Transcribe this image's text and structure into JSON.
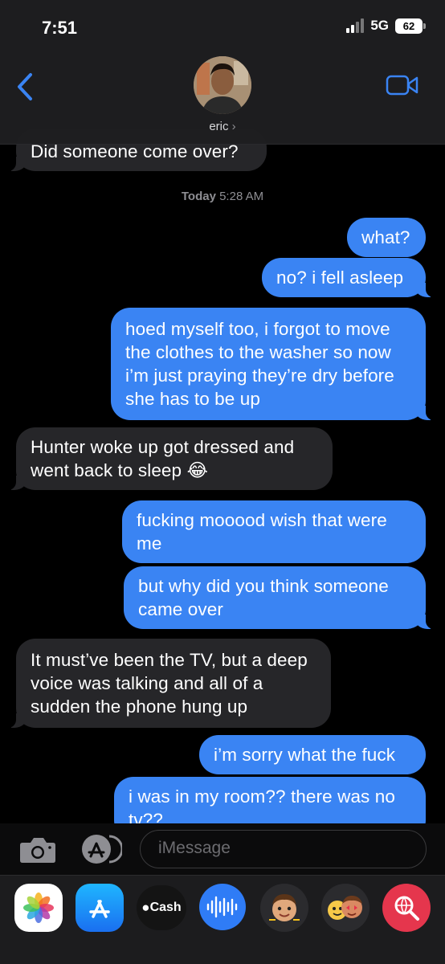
{
  "status_bar": {
    "time": "7:51",
    "network": "5G",
    "battery": "62"
  },
  "header": {
    "contact_name": "eric",
    "chevron": "›"
  },
  "chat": {
    "timestamp_day": "Today",
    "timestamp_time": "5:28 AM",
    "messages": [
      {
        "from": "them",
        "text": "Did someone come over?"
      },
      {
        "from": "me",
        "text": "what?"
      },
      {
        "from": "me",
        "text": "no? i fell asleep"
      },
      {
        "from": "me",
        "text": "hoed myself too, i forgot to move the clothes to the washer so now i’m just praying they’re dry before she has to be up"
      },
      {
        "from": "them",
        "text": "Hunter woke up got dressed and went back to sleep 😂"
      },
      {
        "from": "me",
        "text": "fucking mooood wish that were me"
      },
      {
        "from": "me",
        "text": "but why did you think someone came over"
      },
      {
        "from": "them",
        "text": "It must’ve been the TV, but a deep voice was talking and all of a sudden the phone hung up"
      },
      {
        "from": "me",
        "text": "i’m sorry what the fuck"
      },
      {
        "from": "me",
        "text": "i was in my room?? there was no tv??"
      }
    ]
  },
  "input": {
    "placeholder": "iMessage"
  },
  "drawer": {
    "apps": [
      "photos-icon",
      "app-store-icon",
      "apple-cash-icon",
      "audio-message-icon",
      "memoji-icon",
      "memoji-stickers-icon",
      "search-images-icon"
    ],
    "cash_label": "Cash"
  },
  "colors": {
    "sent": "#3a84f3",
    "received": "#262629",
    "background": "#000000",
    "accent": "#3a84f3"
  }
}
